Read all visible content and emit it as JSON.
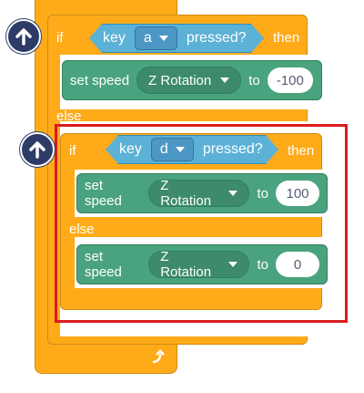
{
  "outer_if": {
    "if_label": "if",
    "then_label": "then",
    "else_label": "else",
    "condition": {
      "key_label": "key",
      "key_value": "a",
      "pressed_label": "pressed?"
    },
    "action": {
      "set_label": "set speed",
      "property": "Z Rotation",
      "to_label": "to",
      "value": "-100"
    }
  },
  "inner_if": {
    "if_label": "if",
    "then_label": "then",
    "else_label": "else",
    "condition": {
      "key_label": "key",
      "key_value": "d",
      "pressed_label": "pressed?"
    },
    "then_action": {
      "set_label": "set speed",
      "property": "Z Rotation",
      "to_label": "to",
      "value": "100"
    },
    "else_action": {
      "set_label": "set speed",
      "property": "Z Rotation",
      "to_label": "to",
      "value": "0"
    }
  },
  "icons": {
    "move_up": "arrow-up-icon",
    "loop": "loop-arrow-icon",
    "dropdown": "caret-down-icon"
  },
  "colors": {
    "control_block": "#FFAB19",
    "sensing_block": "#5CB1D6",
    "motion_block": "#4AA37F",
    "move_up_button": "#2D3B67",
    "highlight_box": "#D91B1B"
  }
}
